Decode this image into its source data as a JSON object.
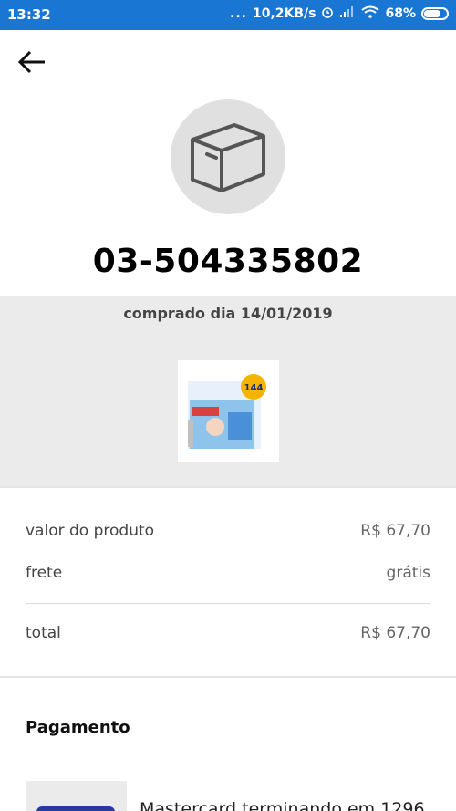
{
  "status_bar": {
    "time": "13:32",
    "dots": "...",
    "speed": "10,2KB/s",
    "battery": "68%"
  },
  "header": {
    "back_icon": "arrow-left-icon"
  },
  "order": {
    "icon": "package-box-icon",
    "id": "03-504335802",
    "purchased_text": "comprado dia 14/01/2019"
  },
  "product": {
    "image_badge": "144"
  },
  "summary": {
    "product_value_label": "valor do produto",
    "product_value": "R$ 67,70",
    "shipping_label": "frete",
    "shipping_value": "grátis",
    "total_label": "total",
    "total_value": "R$ 67,70"
  },
  "payment": {
    "title": "Pagamento",
    "card_text": "Mastercard terminando em 1296",
    "card_icon": "credit-card-icon"
  },
  "colors": {
    "status_bar": "#1976d2",
    "band": "#ebebeb",
    "card": "#2a3a9c"
  }
}
